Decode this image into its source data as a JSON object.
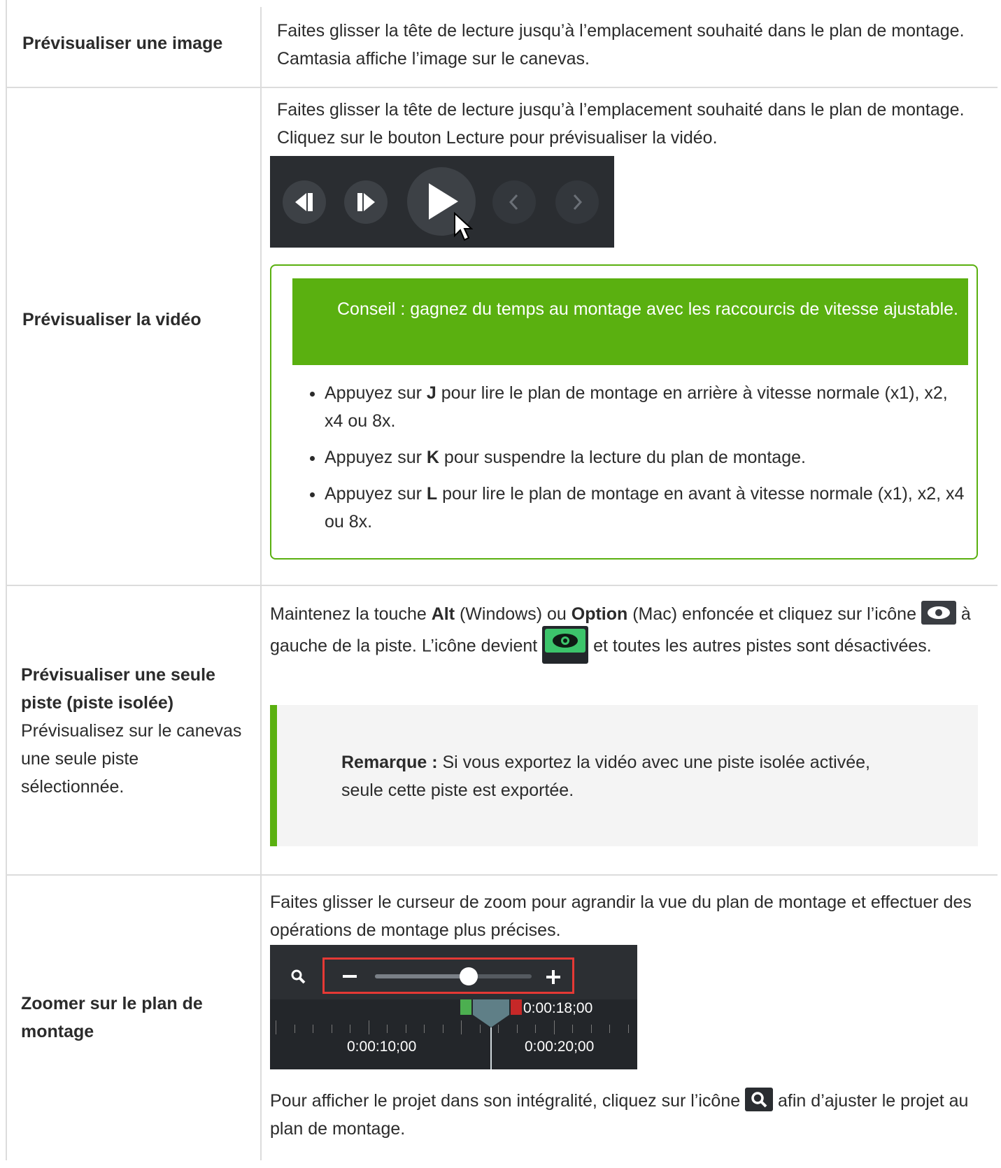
{
  "rows": [
    {
      "label": "Prévisualiser une image",
      "text": "Faites glisser la tête de lecture jusqu’à l’emplacement souhaité dans le plan de montage. Camtasia affiche l’image sur le canevas."
    },
    {
      "label": "Prévisualiser la vidéo",
      "text": "Faites glisser la tête de lecture jusqu’à l’emplacement souhaité dans le plan de montage. Cliquez sur le bouton Lecture pour prévisualiser la vidéo.",
      "tip": "Conseil : gagnez du temps au montage avec les raccourcis de vitesse ajustable.",
      "bullets": [
        {
          "pre": "Appuyez sur ",
          "key": "J",
          "post": " pour lire le plan de montage en arrière à vitesse normale (x1), x2, x4 ou 8x."
        },
        {
          "pre": "Appuyez sur ",
          "key": "K",
          "post": " pour suspendre la lecture du plan de montage."
        },
        {
          "pre": "Appuyez sur ",
          "key": "L",
          "post": " pour lire le plan de montage en avant à vitesse normale (x1), x2, x4 ou 8x."
        }
      ]
    },
    {
      "label_bold": "Prévisualiser une seule piste (piste isolée)",
      "label_sub": "Prévisualisez sur le canevas une seule piste sélectionnée.",
      "t1": "Maintenez la touche ",
      "k1": "Alt",
      "t2": " (Windows) ou ",
      "k2": "Option",
      "t3": " (Mac) enfoncée et cliquez sur l’icône ",
      "t4": " à gauche de la piste. L’icône devient ",
      "t5": " et toutes les autres pistes sont désactivées.",
      "note_bold": "Remarque :",
      "note_text": " Si vous exportez la vidéo avec une piste isolée activée, seule cette piste est exportée."
    },
    {
      "label": "Zoomer sur le plan de montage",
      "text": "Faites glisser le curseur de zoom pour agrandir la vue du plan de montage et effectuer des opérations de montage plus précises.",
      "time_current": "0:00:18;00",
      "tick1": "0:00:10;00",
      "tick2": "0:00:20;00",
      "after1": "Pour afficher le projet dans son intégralité, cliquez sur l’icône ",
      "after2": " afin d’ajuster le projet au plan de montage."
    }
  ],
  "colors": {
    "accent_green": "#5ab010",
    "border": "#dcdcdc",
    "dark_ui": "#2a2d31",
    "highlight_red": "#e53935"
  },
  "zoom_slider_level": 0.6
}
